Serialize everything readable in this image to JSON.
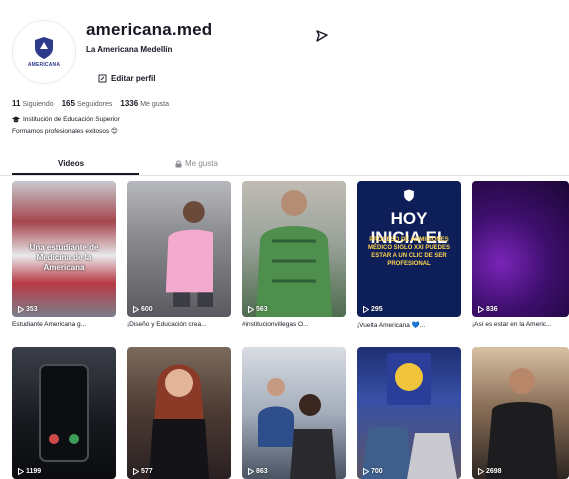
{
  "profile": {
    "username": "americana.med",
    "display_name": "La Americana Medellín",
    "avatar_text": "AMERICANA",
    "edit_label": "Editar perfil",
    "stats": [
      {
        "value": "11",
        "label": "Siguiendo"
      },
      {
        "value": "165",
        "label": "Seguidores"
      },
      {
        "value": "1336",
        "label": "Me gusta"
      }
    ],
    "bio_line1": "Institución de Educación Superior",
    "bio_line2": "Formamos profesionales exitosos 😊"
  },
  "tabs": [
    {
      "label": "Videos"
    },
    {
      "label": "Me gusta"
    }
  ],
  "videos": [
    {
      "views": "353",
      "caption": "Estudiante Americana g...",
      "overlay": "Una estudiante de Medicina de la Americana"
    },
    {
      "views": "600",
      "caption": "¡Diseño y Educación crea...",
      "overlay": ""
    },
    {
      "views": "563",
      "caption": "#institucionvillegas O...",
      "overlay": ""
    },
    {
      "views": "295",
      "caption": "¡Vuelta Americana 💙...",
      "overlay": "HOY INICIA EL",
      "overlay_sub": "PROCESO DE ADMISIONES MÉDICO SIGLO XXI PUEDES ESTAR A UN CLIC DE SER PROFESIONAL"
    },
    {
      "views": "836",
      "caption": "¡Así es estar en la Americ...",
      "overlay": ""
    },
    {
      "views": "1199",
      "caption": "",
      "overlay": ""
    },
    {
      "views": "577",
      "caption": "",
      "overlay": ""
    },
    {
      "views": "863",
      "caption": "",
      "overlay": ""
    },
    {
      "views": "700",
      "caption": "",
      "overlay": ""
    },
    {
      "views": "2698",
      "caption": "",
      "overlay": ""
    }
  ],
  "colors": {
    "text": "#161823",
    "muted": "#8a8b91",
    "brand": "#2d3a8c"
  }
}
